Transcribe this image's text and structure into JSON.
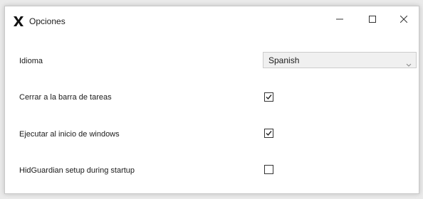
{
  "window": {
    "title": "Opciones",
    "icon": "x-logo-icon",
    "controls": {
      "minimize": "minimize-icon",
      "maximize": "maximize-icon",
      "close": "close-icon"
    }
  },
  "options": {
    "language": {
      "label": "Idioma",
      "selected": "Spanish"
    },
    "close_to_tray": {
      "label": "Cerrar a la barra de tareas",
      "checked": true
    },
    "run_at_startup": {
      "label": "Ejecutar al inicio de windows",
      "checked": true
    },
    "hidguardian_setup": {
      "label": "HidGuardian setup during startup",
      "checked": false
    }
  },
  "colors": {
    "window_bg": "#ffffff",
    "text": "#1a1a1a",
    "select_bg": "#f0f0f0",
    "checkbox_border": "#333333"
  }
}
